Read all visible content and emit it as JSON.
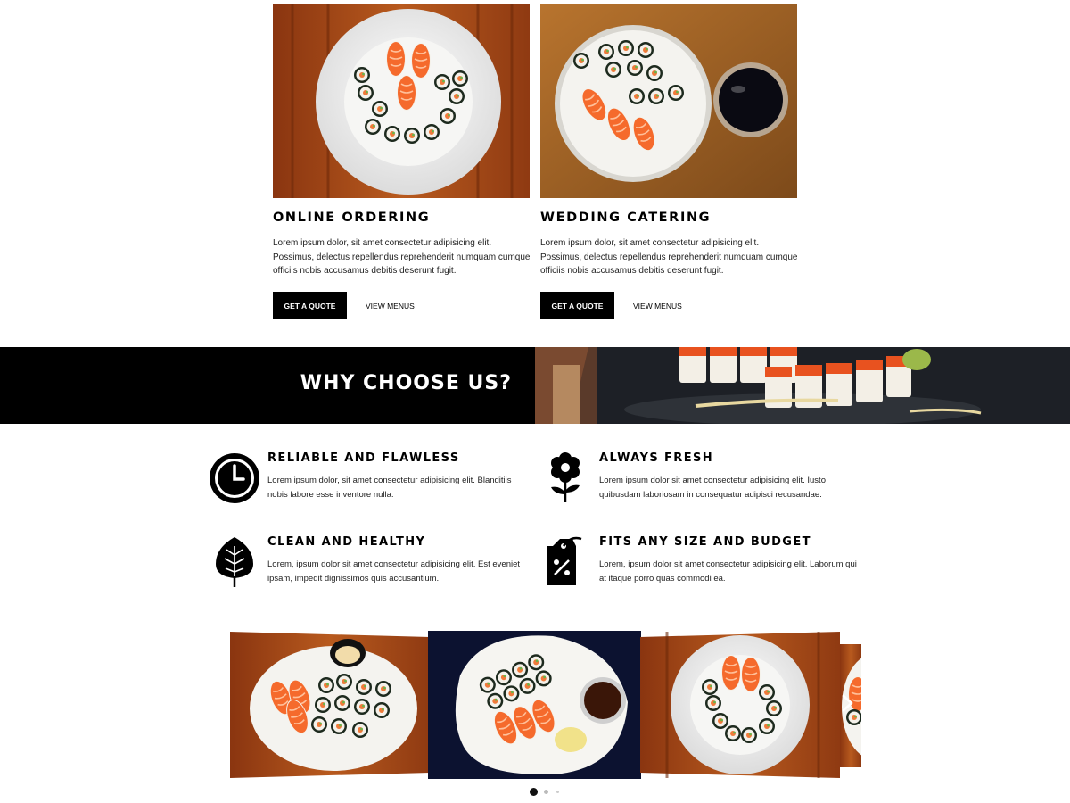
{
  "services": [
    {
      "title": "ONLINE ORDERING",
      "text": "Lorem ipsum dolor, sit amet consectetur adipisicing elit. Possimus, delectus repellendus reprehenderit numquam cumque officiis nobis accusamus debitis deserunt fugit.",
      "button": "GET A QUOTE",
      "link": "VIEW MENUS",
      "photo": "sushi-plate-on-wood-photo"
    },
    {
      "title": "WEDDING CATERING",
      "text": "Lorem ipsum dolor, sit amet consectetur adipisicing elit. Possimus, delectus repellendus reprehenderit numquam cumque officiis nobis accusamus debitis deserunt fugit.",
      "button": "GET A QUOTE",
      "link": "VIEW MENUS",
      "photo": "sushi-with-soy-sauce-photo"
    }
  ],
  "why": {
    "title": "WHY CHOOSE US?",
    "photo": "sushi-rolls-banner-photo"
  },
  "features": [
    {
      "icon": "clock-icon",
      "title": "RELIABLE AND FLAWLESS",
      "text": "Lorem ipsum dolor, sit amet consectetur adipisicing elit. Blanditiis nobis labore esse inventore nulla."
    },
    {
      "icon": "flower-icon",
      "title": "ALWAYS FRESH",
      "text": "Lorem ipsum dolor sit amet consectetur adipisicing elit. Iusto quibusdam laboriosam in consequatur adipisci recusandae."
    },
    {
      "icon": "leaf-icon",
      "title": "CLEAN AND HEALTHY",
      "text": "Lorem, ipsum dolor sit amet consectetur adipisicing elit. Est eveniet ipsam, impedit dignissimos quis accusantium."
    },
    {
      "icon": "price-tag-icon",
      "title": "FITS ANY SIZE AND BUDGET",
      "text": "Lorem, ipsum dolor sit amet consectetur adipisicing elit. Laborum qui at itaque porro quas commodi ea."
    }
  ],
  "carousel": {
    "slides": [
      "sushi-plate-with-ginger-photo",
      "sushi-plate-dark-background-photo",
      "sushi-plate-on-wood-photo",
      "sushi-plate-partial-photo"
    ],
    "active_dot": 0,
    "dot_count": 3,
    "next_icon": "chevron-right-icon"
  },
  "colors": {
    "black": "#000000",
    "salmon": "#f26a2a",
    "wood": "#a34a15",
    "plate": "#f2f2f0"
  }
}
